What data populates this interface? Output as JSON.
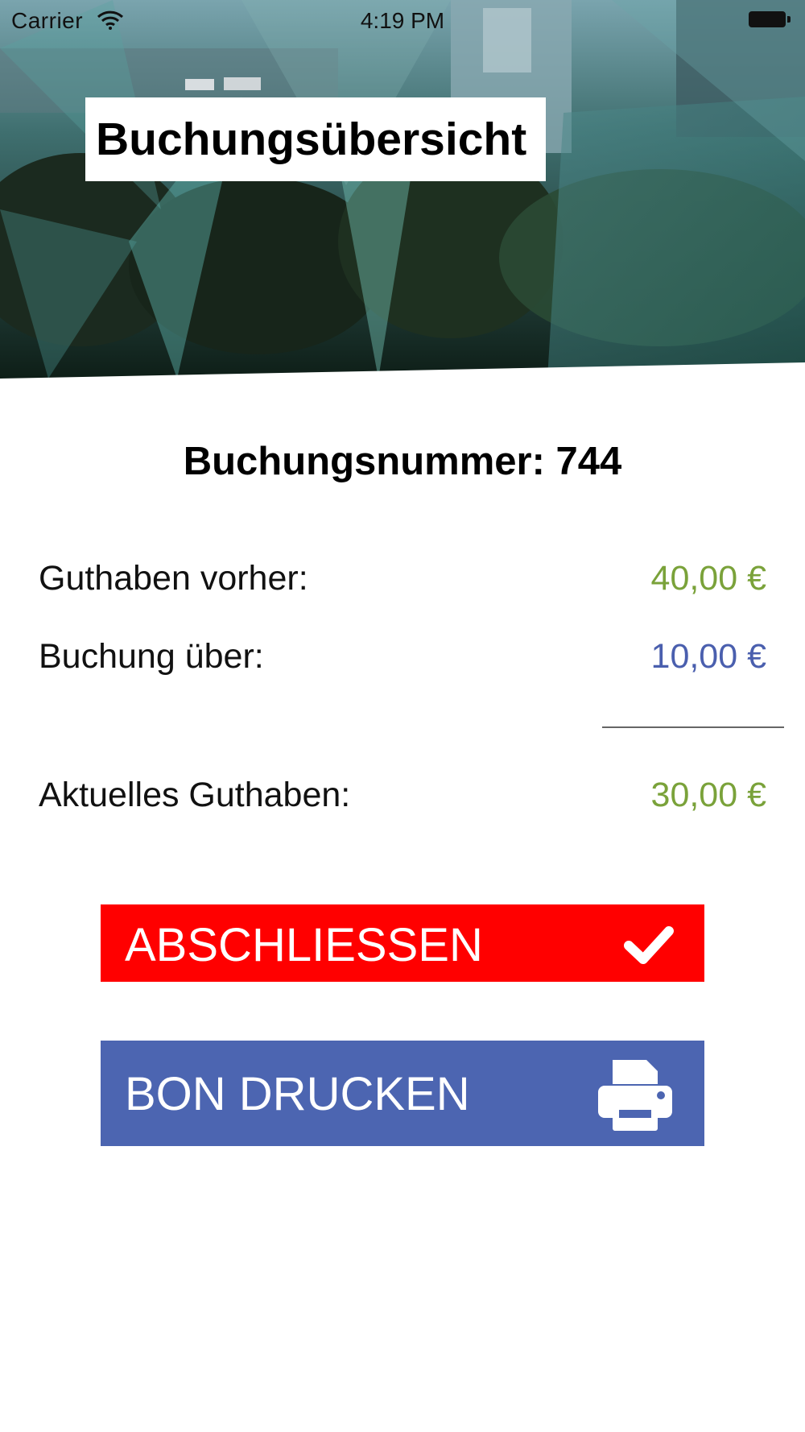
{
  "status_bar": {
    "carrier": "Carrier",
    "time": "4:19 PM"
  },
  "header": {
    "title": "Buchungsübersicht"
  },
  "summary": {
    "booking_number_text": "Buchungsnummer: 744",
    "rows": [
      {
        "label": "Guthaben vorher:",
        "value": "40,00 €",
        "color": "#7aa23a"
      },
      {
        "label": "Buchung über:",
        "value": "10,00 €",
        "color": "#4a5fae"
      },
      {
        "label": "Aktuelles Guthaben:",
        "value": "30,00 €",
        "color": "#7aa23a"
      }
    ]
  },
  "actions": {
    "close_label": "ABSCHLIESSEN",
    "close_icon": "checkmark-icon",
    "close_color": "#ff0000",
    "print_label": "BON DRUCKEN",
    "print_icon": "printer-icon",
    "print_color": "#4c65b1"
  }
}
